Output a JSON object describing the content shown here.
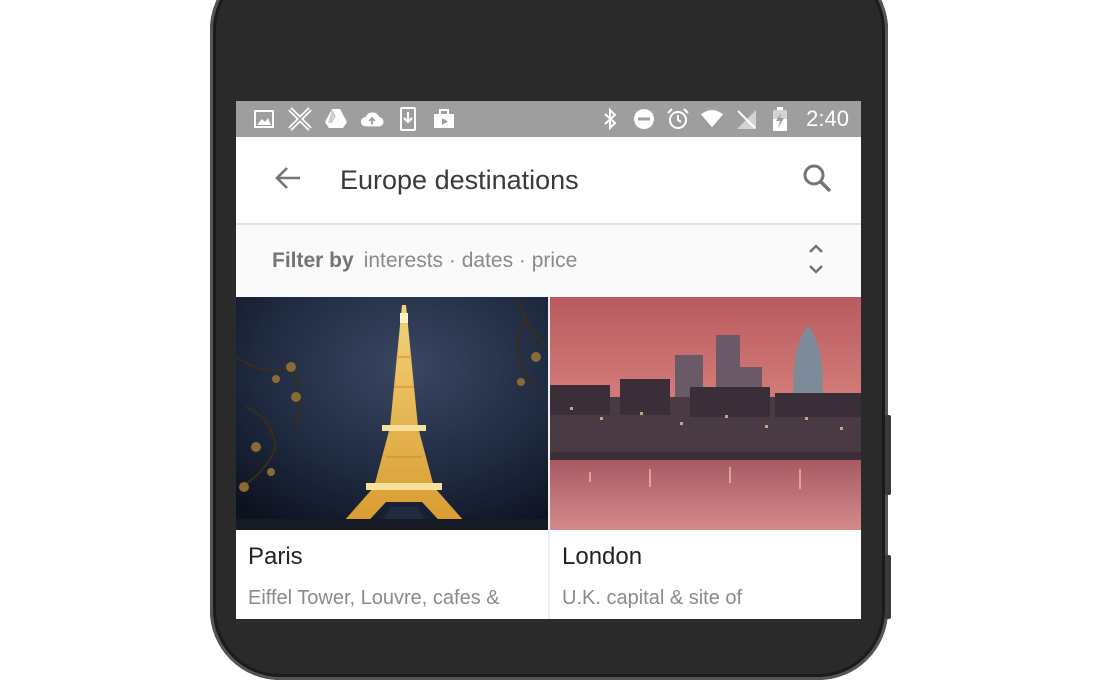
{
  "status_bar": {
    "time": "2:40",
    "left_icons": [
      "image-icon",
      "app-x-icon",
      "drive-icon",
      "cloud-upload-icon",
      "download-icon",
      "work-icon"
    ],
    "right_icons": [
      "bluetooth-icon",
      "do-not-disturb-icon",
      "alarm-icon",
      "wifi-icon",
      "no-sim-icon",
      "battery-charging-icon"
    ]
  },
  "app_bar": {
    "title": "Europe destinations",
    "back_icon": "arrow-back-icon",
    "search_icon": "search-icon"
  },
  "filter": {
    "label": "Filter by",
    "options": "interests · dates · price",
    "expand_icon": "unfold-more-icon"
  },
  "destinations": [
    {
      "name": "Paris",
      "description": "Eiffel Tower, Louvre, cafes &"
    },
    {
      "name": "London",
      "description": "U.K. capital & site of"
    }
  ],
  "colors": {
    "status_bar": "#9e9e9e",
    "app_bar": "#ffffff",
    "filter_bar": "#fafafa",
    "phone_body": "#2a2a2a"
  }
}
